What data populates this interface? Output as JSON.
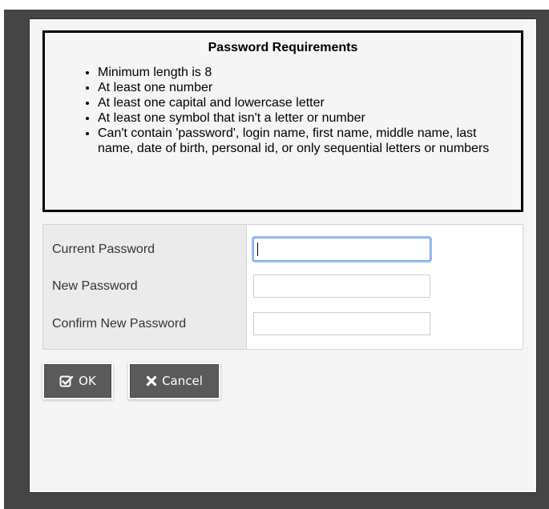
{
  "requirements": {
    "title": "Password Requirements",
    "items": [
      "Minimum length is 8",
      "At least one number",
      "At least one capital and lowercase letter",
      "At least one symbol that isn't a letter or number",
      "Can't contain 'password', login name, first name, middle name, last name, date of birth, personal id, or only sequential letters or numbers"
    ]
  },
  "form": {
    "current_label": "Current Password",
    "new_label": "New Password",
    "confirm_label": "Confirm New Password",
    "current_value": "",
    "new_value": "",
    "confirm_value": ""
  },
  "buttons": {
    "ok_label": "OK",
    "ok_icon": "check-square-icon",
    "cancel_label": "Cancel",
    "cancel_icon": "close-icon"
  },
  "colors": {
    "frame": "#454545",
    "dialog_bg": "#f5f5f5",
    "button_bg": "#5a5a5a",
    "focus_ring": "#7aa7ee"
  }
}
